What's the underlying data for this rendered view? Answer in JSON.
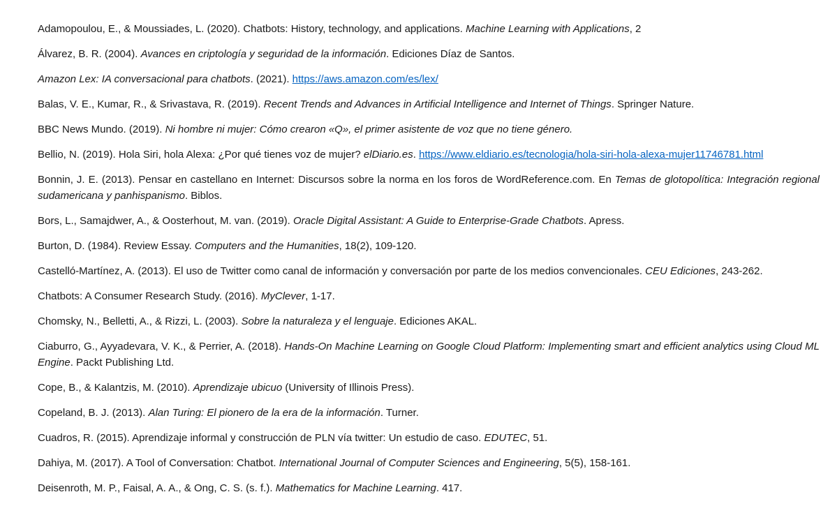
{
  "references": [
    [
      {
        "t": "Adamopoulou, E., & Moussiades, L. (2020). Chatbots: History, technology, and applications. "
      },
      {
        "t": "Machine Learning with Applications",
        "i": true
      },
      {
        "t": ", 2"
      }
    ],
    [
      {
        "t": "Álvarez, B. R. (2004). "
      },
      {
        "t": "Avances en criptología y seguridad de la información",
        "i": true
      },
      {
        "t": ". Ediciones Díaz de Santos."
      }
    ],
    [
      {
        "t": "Amazon Lex: IA conversacional para chatbots",
        "i": true
      },
      {
        "t": ". (2021). "
      },
      {
        "t": "https://aws.amazon.com/es/lex/",
        "link": true
      }
    ],
    [
      {
        "t": "Balas, V. E., Kumar, R., & Srivastava, R. (2019). "
      },
      {
        "t": "Recent Trends and Advances in Artificial Intelligence and Internet of Things",
        "i": true
      },
      {
        "t": ". Springer Nature."
      }
    ],
    [
      {
        "t": "BBC News Mundo. (2019). "
      },
      {
        "t": "Ni hombre ni mujer: Cómo crearon «Q», el primer asistente de voz que no tiene género.",
        "i": true
      }
    ],
    [
      {
        "t": "Bellio, N. (2019). Hola Siri, hola Alexa: ¿Por qué tienes voz de mujer? "
      },
      {
        "t": "elDiario.es",
        "i": true
      },
      {
        "t": ". "
      },
      {
        "t": "https://www.eldiario.es/tecnologia/hola-siri-hola-alexa-mujer11746781.html",
        "link": true
      }
    ],
    [
      {
        "t": "Bonnin, J. E. (2013). Pensar en castellano en Internet: Discursos sobre la norma en los foros de WordReference.com. En "
      },
      {
        "t": "Temas de glotopolítica: Integración regional sudamericana y panhispanismo",
        "i": true
      },
      {
        "t": ". Biblos."
      }
    ],
    [
      {
        "t": "Bors, L., Samajdwer, A., & Oosterhout, M. van. (2019). "
      },
      {
        "t": "Oracle Digital Assistant: A Guide to Enterprise-Grade Chatbots",
        "i": true
      },
      {
        "t": ". Apress."
      }
    ],
    [
      {
        "t": "Burton, D. (1984). Review Essay. "
      },
      {
        "t": "Computers and the Humanities",
        "i": true
      },
      {
        "t": ", 18(2), 109-120."
      }
    ],
    [
      {
        "t": "Castelló-Martínez, A. (2013). El uso de Twitter como canal de información y conversación por parte de los medios convencionales. "
      },
      {
        "t": "CEU Ediciones",
        "i": true
      },
      {
        "t": ", 243-262."
      }
    ],
    [
      {
        "t": "Chatbots: A Consumer Research Study. (2016). "
      },
      {
        "t": "MyClever",
        "i": true
      },
      {
        "t": ", 1-17."
      }
    ],
    [
      {
        "t": "Chomsky, N., Belletti, A., & Rizzi, L. (2003). "
      },
      {
        "t": "Sobre la naturaleza y el lenguaje",
        "i": true
      },
      {
        "t": ". Ediciones AKAL."
      }
    ],
    [
      {
        "t": "Ciaburro, G., Ayyadevara, V. K., & Perrier, A. (2018). "
      },
      {
        "t": "Hands-On Machine Learning on Google Cloud Platform: Implementing smart and efficient analytics using Cloud ML Engine",
        "i": true
      },
      {
        "t": ". Packt Publishing Ltd."
      }
    ],
    [
      {
        "t": "Cope, B., & Kalantzis, M. (2010). "
      },
      {
        "t": "Aprendizaje ubicuo",
        "i": true
      },
      {
        "t": " (University of Illinois Press)."
      }
    ],
    [
      {
        "t": "Copeland, B. J. (2013). "
      },
      {
        "t": "Alan Turing: El pionero de la era de la información",
        "i": true
      },
      {
        "t": ". Turner."
      }
    ],
    [
      {
        "t": "Cuadros, R. (2015). Aprendizaje informal y construcción de PLN vía twitter: Un estudio de caso. "
      },
      {
        "t": "EDUTEC",
        "i": true
      },
      {
        "t": ", 51."
      }
    ],
    [
      {
        "t": "Dahiya, M. (2017). A Tool of Conversation: Chatbot. "
      },
      {
        "t": "International Journal of Computer Sciences and Engineering",
        "i": true
      },
      {
        "t": ", 5(5), 158-161."
      }
    ],
    [
      {
        "t": "Deisenroth, M. P., Faisal, A. A., & Ong, C. S. (s. f.). "
      },
      {
        "t": "Mathematics for Machine Learning",
        "i": true
      },
      {
        "t": ". 417."
      }
    ]
  ]
}
